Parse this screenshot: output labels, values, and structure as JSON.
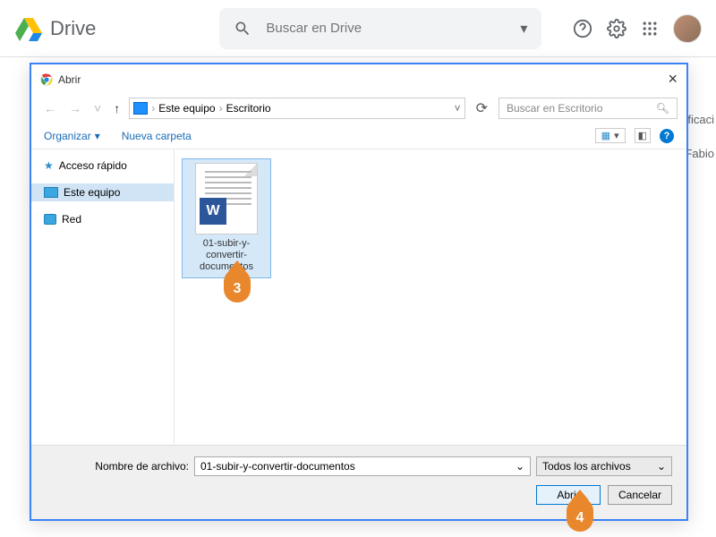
{
  "header": {
    "app_title": "Drive",
    "search_placeholder": "Buscar en Drive"
  },
  "bg": {
    "right1": "ificaci",
    "right2": "Fabio"
  },
  "dialog": {
    "title": "Abrir",
    "breadcrumb": {
      "root": "Este equipo",
      "current": "Escritorio"
    },
    "search_placeholder": "Buscar en Escritorio",
    "toolbar": {
      "organize": "Organizar",
      "new_folder": "Nueva carpeta"
    },
    "tree": {
      "quick": "Acceso rápido",
      "pc": "Este equipo",
      "net": "Red"
    },
    "file": {
      "name": "01-subir-y-convertir-documentos",
      "badge": "W"
    },
    "footer": {
      "filename_label": "Nombre de archivo:",
      "filename_value": "01-subir-y-convertir-documentos",
      "filetype": "Todos los archivos",
      "open": "Abrir",
      "cancel": "Cancelar"
    }
  },
  "callouts": {
    "c3": "3",
    "c4": "4"
  }
}
